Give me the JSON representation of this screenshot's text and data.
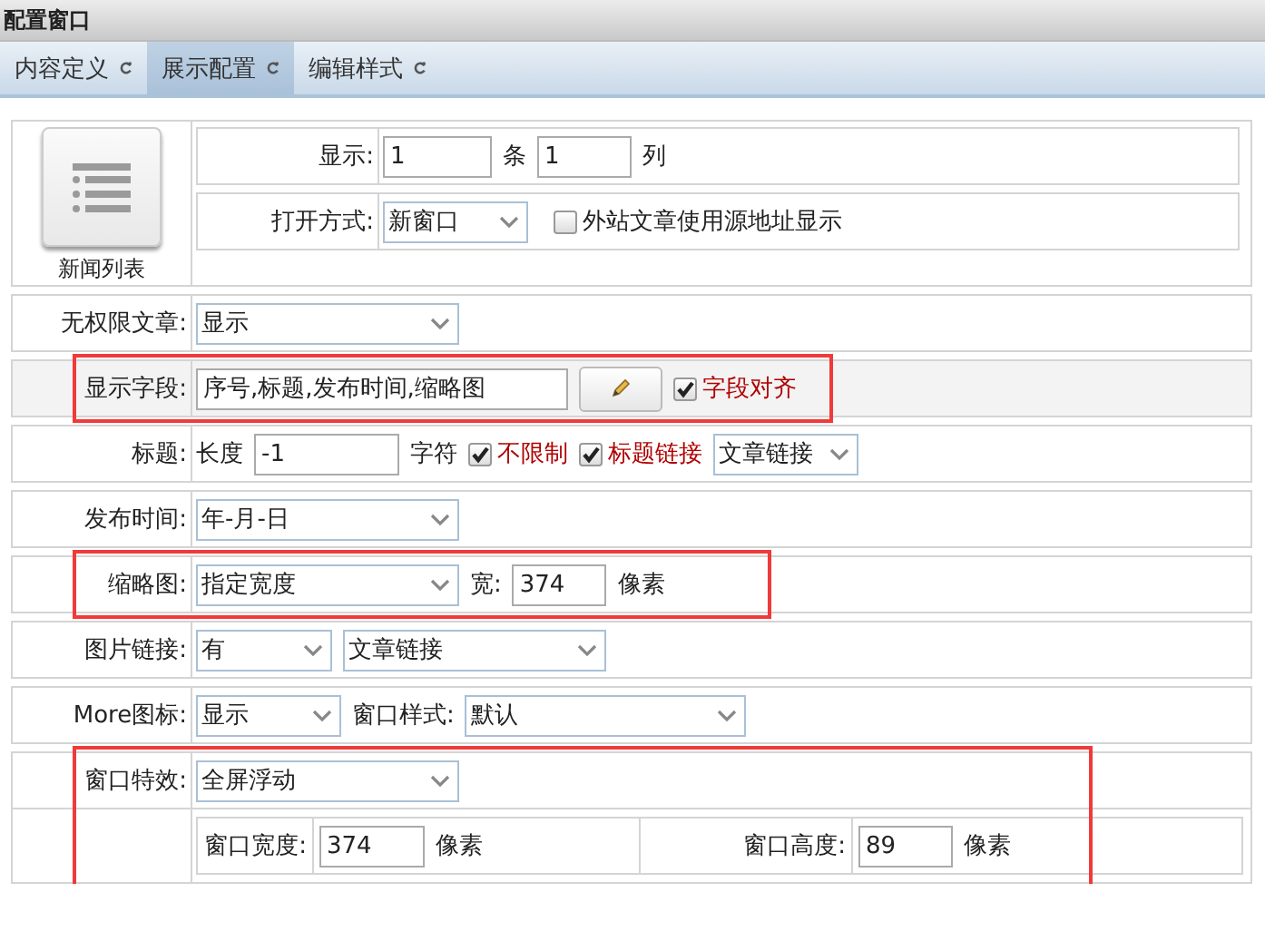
{
  "window": {
    "title": "配置窗口"
  },
  "tabs": [
    {
      "label": "内容定义",
      "selected": false
    },
    {
      "label": "展示配置",
      "selected": true
    },
    {
      "label": "编辑样式",
      "selected": false
    }
  ],
  "module": {
    "label": "新闻列表"
  },
  "module_settings": [
    {
      "label": "显示:",
      "items": [
        {
          "kind": "input",
          "value": "1"
        },
        {
          "kind": "text",
          "text": "条"
        },
        {
          "kind": "input",
          "value": "1"
        },
        {
          "kind": "text",
          "text": "列"
        }
      ]
    },
    {
      "label": "打开方式:",
      "items": [
        {
          "kind": "select",
          "value": "新窗口"
        },
        {
          "kind": "checkbox",
          "label": "外站文章使用源地址显示",
          "checked": false
        }
      ]
    }
  ],
  "rows": [
    {
      "label": "无权限文章:",
      "highlighted": false,
      "items": [
        {
          "kind": "select",
          "value": "显示"
        }
      ]
    },
    {
      "label": "显示字段:",
      "highlighted": true,
      "items": [
        {
          "kind": "input",
          "value": "序号,标题,发布时间,缩略图"
        },
        {
          "kind": "button"
        },
        {
          "kind": "checkbox",
          "label": "字段对齐",
          "checked": true
        }
      ]
    },
    {
      "label": "标题:",
      "highlighted": false,
      "items": [
        {
          "kind": "text",
          "text": "长度"
        },
        {
          "kind": "input",
          "value": "-1"
        },
        {
          "kind": "text",
          "text": "字符"
        },
        {
          "kind": "checkbox",
          "label": "不限制",
          "checked": true
        },
        {
          "kind": "checkbox",
          "label": "标题链接",
          "checked": true
        },
        {
          "kind": "select",
          "value": "文章链接"
        }
      ]
    },
    {
      "label": "发布时间:",
      "highlighted": false,
      "items": [
        {
          "kind": "select",
          "value": "年-月-日"
        }
      ]
    },
    {
      "label": "缩略图:",
      "highlighted": true,
      "items": [
        {
          "kind": "select",
          "value": "指定宽度"
        },
        {
          "kind": "text",
          "text": "宽:"
        },
        {
          "kind": "input",
          "value": "374"
        },
        {
          "kind": "text",
          "text": "像素"
        }
      ]
    },
    {
      "label": "图片链接:",
      "highlighted": false,
      "items": [
        {
          "kind": "select",
          "value": "有"
        },
        {
          "kind": "select",
          "value": "文章链接"
        }
      ]
    },
    {
      "label": "More图标:",
      "highlighted": false,
      "items": [
        {
          "kind": "select",
          "value": "显示"
        },
        {
          "kind": "text",
          "text": "窗口样式:"
        },
        {
          "kind": "select",
          "value": "默认"
        }
      ]
    },
    {
      "label": "窗口特效:",
      "highlighted": true,
      "items": [
        {
          "kind": "select",
          "value": "全屏浮动"
        }
      ],
      "details": [
        {
          "label": "窗口宽度:",
          "value": "374",
          "unit": "像素"
        },
        {
          "label": "窗口高度:",
          "value": "89",
          "unit": "像素"
        }
      ]
    }
  ]
}
